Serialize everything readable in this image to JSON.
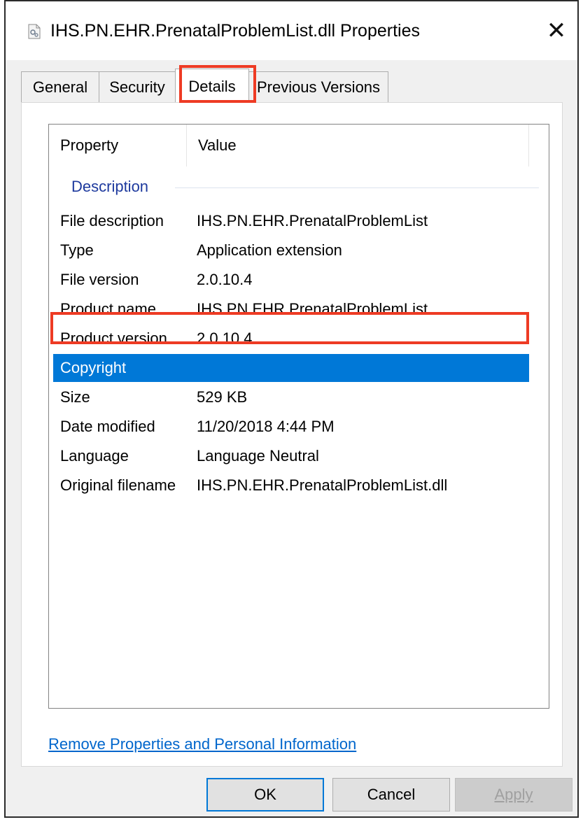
{
  "window": {
    "title": "IHS.PN.EHR.PrenatalProblemList.dll Properties",
    "icon": "dll-file-icon",
    "close_glyph": "✕"
  },
  "tabs": [
    {
      "label": "General",
      "active": false
    },
    {
      "label": "Security",
      "active": false
    },
    {
      "label": "Details",
      "active": true
    },
    {
      "label": "Previous Versions",
      "active": false
    }
  ],
  "details": {
    "columns": [
      "Property",
      "Value"
    ],
    "group": "Description",
    "rows": [
      {
        "property": "File description",
        "value": "IHS.PN.EHR.PrenatalProblemList"
      },
      {
        "property": "Type",
        "value": "Application extension"
      },
      {
        "property": "File version",
        "value": "2.0.10.4"
      },
      {
        "property": "Product name",
        "value": "IHS.PN.EHR.PrenatalProblemList"
      },
      {
        "property": "Product version",
        "value": "2.0.10.4"
      },
      {
        "property": "Copyright",
        "value": ""
      },
      {
        "property": "Size",
        "value": "529 KB"
      },
      {
        "property": "Date modified",
        "value": "11/20/2018 4:44 PM"
      },
      {
        "property": "Language",
        "value": "Language Neutral"
      },
      {
        "property": "Original filename",
        "value": "IHS.PN.EHR.PrenatalProblemList.dll"
      }
    ],
    "selected_row": "Copyright"
  },
  "links": {
    "remove_properties": "Remove Properties and Personal Information"
  },
  "buttons": {
    "ok": "OK",
    "cancel": "Cancel",
    "apply": "Apply"
  },
  "colors": {
    "accent": "#0078d7",
    "highlight": "#ee3b24",
    "link": "#0066cc",
    "group_label": "#1e3a9e"
  }
}
